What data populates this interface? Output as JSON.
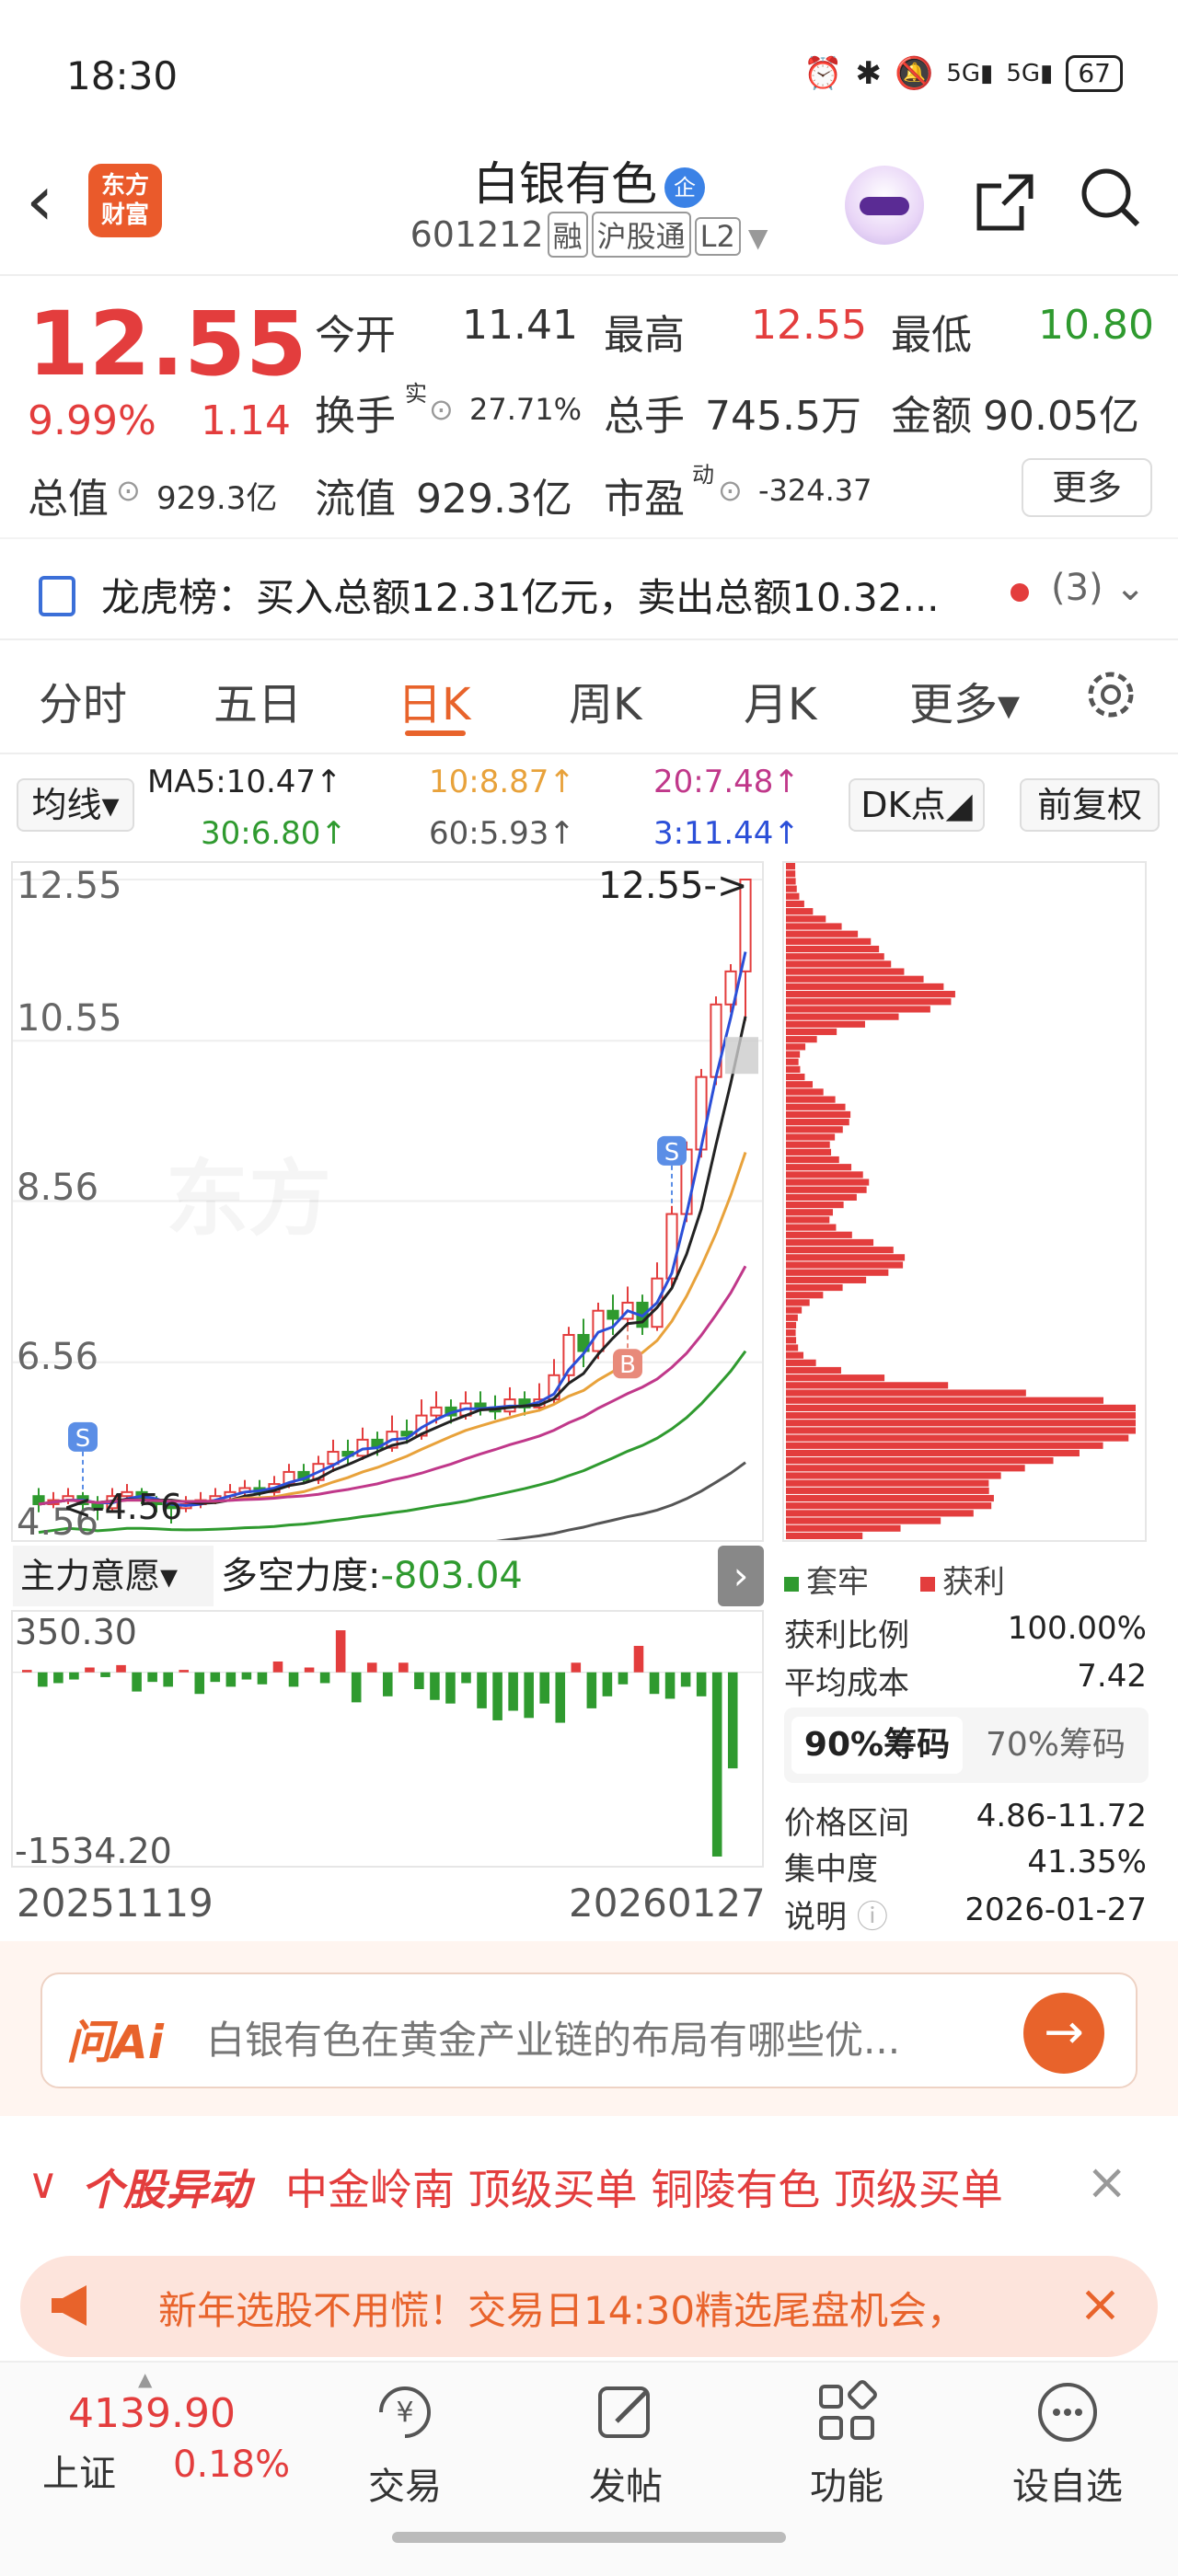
{
  "status": {
    "time": "18:30",
    "battery": "67",
    "signal1": "5G",
    "signal2": "5G"
  },
  "header": {
    "logo_line1": "东方",
    "logo_line2": "财富",
    "name": "白银有色",
    "badge": "企",
    "code": "601212",
    "tags": [
      "融",
      "沪股通",
      "L2"
    ]
  },
  "quote": {
    "price": "12.55",
    "pct": "9.99%",
    "change": "1.14",
    "open_label": "今开",
    "open": "11.41",
    "high_label": "最高",
    "high": "12.55",
    "low_label": "最低",
    "low": "10.80",
    "turnover_label": "换手",
    "turnover_sup": "实",
    "turnover": "27.71%",
    "volume_label": "总手",
    "volume": "745.5万",
    "amount_label": "金额",
    "amount": "90.05亿",
    "mktcap_label": "总值",
    "mktcap": "929.3亿",
    "float_label": "流值",
    "float": "929.3亿",
    "pe_label": "市盈",
    "pe_sup": "动",
    "pe": "-324.37",
    "more": "更多"
  },
  "lhb": {
    "text": "龙虎榜：买入总额12.31亿元，卖出总额10.32...",
    "count": "(3)"
  },
  "tabs": [
    "分时",
    "五日",
    "日K",
    "周K",
    "月K",
    "更多▾"
  ],
  "ma": {
    "toggle": "均线▾",
    "ma5": "MA5:10.47↑",
    "ma10": "10:8.87↑",
    "ma20": "20:7.48↑",
    "ma30": "30:6.80↑",
    "ma60": "60:5.93↑",
    "ma3": "3:11.44↑",
    "dk": "DK点◢",
    "fq": "前复权"
  },
  "colors": {
    "red": "#e33d3d",
    "green": "#2f9a2f",
    "orange": "#e8632b",
    "ma5": "#222222",
    "ma10": "#e8a23b",
    "ma20": "#c0388a",
    "ma30": "#2f9a2f",
    "ma60": "#555555",
    "ma3": "#2b4fd8"
  },
  "chart_data": [
    {
      "type": "candlestick",
      "price_ticks": [
        "12.55",
        "10.55",
        "8.56",
        "6.56",
        "4.56"
      ],
      "ylim": [
        4.56,
        12.55
      ],
      "last_price_label": "12.55->",
      "low_marker": "<-4.56",
      "candles": [
        [
          4.9,
          4.8,
          5.0,
          4.7
        ],
        [
          4.8,
          4.85,
          4.95,
          4.75
        ],
        [
          4.85,
          4.9,
          5.0,
          4.8
        ],
        [
          4.9,
          4.8,
          4.95,
          4.7
        ],
        [
          4.8,
          4.75,
          4.9,
          4.6
        ],
        [
          4.75,
          4.9,
          5.0,
          4.7
        ],
        [
          4.9,
          4.95,
          5.05,
          4.85
        ],
        [
          4.95,
          4.85,
          5.0,
          4.8
        ],
        [
          4.85,
          4.8,
          4.9,
          4.7
        ],
        [
          4.8,
          4.75,
          4.85,
          4.56
        ],
        [
          4.75,
          4.8,
          4.9,
          4.7
        ],
        [
          4.8,
          4.85,
          4.95,
          4.75
        ],
        [
          4.85,
          4.9,
          5.0,
          4.8
        ],
        [
          4.9,
          4.95,
          5.05,
          4.85
        ],
        [
          4.95,
          5.0,
          5.1,
          4.9
        ],
        [
          5.0,
          4.95,
          5.1,
          4.9
        ],
        [
          4.95,
          5.05,
          5.15,
          4.9
        ],
        [
          5.05,
          5.2,
          5.3,
          5.0
        ],
        [
          5.2,
          5.1,
          5.3,
          5.05
        ],
        [
          5.1,
          5.3,
          5.4,
          5.05
        ],
        [
          5.3,
          5.45,
          5.6,
          5.2
        ],
        [
          5.45,
          5.4,
          5.6,
          5.3
        ],
        [
          5.4,
          5.6,
          5.75,
          5.35
        ],
        [
          5.6,
          5.5,
          5.7,
          5.4
        ],
        [
          5.5,
          5.7,
          5.9,
          5.45
        ],
        [
          5.7,
          5.65,
          5.85,
          5.55
        ],
        [
          5.65,
          5.9,
          6.1,
          5.6
        ],
        [
          5.9,
          6.0,
          6.2,
          5.8
        ],
        [
          6.0,
          5.9,
          6.1,
          5.8
        ],
        [
          5.9,
          6.05,
          6.2,
          5.85
        ],
        [
          6.05,
          6.0,
          6.2,
          5.9
        ],
        [
          6.0,
          5.95,
          6.15,
          5.85
        ],
        [
          5.95,
          6.1,
          6.25,
          5.9
        ],
        [
          6.1,
          6.0,
          6.2,
          5.9
        ],
        [
          6.0,
          6.1,
          6.3,
          5.95
        ],
        [
          6.1,
          6.4,
          6.6,
          6.05
        ],
        [
          6.4,
          6.9,
          7.0,
          6.3
        ],
        [
          6.9,
          6.7,
          7.1,
          6.5
        ],
        [
          6.7,
          7.2,
          7.3,
          6.6
        ],
        [
          7.2,
          7.1,
          7.4,
          6.9
        ],
        [
          7.1,
          7.3,
          7.5,
          7.0
        ],
        [
          7.3,
          7.0,
          7.4,
          6.9
        ],
        [
          7.0,
          7.6,
          7.8,
          6.95
        ],
        [
          7.6,
          8.4,
          8.5,
          7.5
        ],
        [
          8.4,
          9.2,
          9.3,
          8.3
        ],
        [
          9.2,
          10.1,
          10.2,
          9.1
        ],
        [
          10.1,
          11.0,
          11.1,
          10.0
        ],
        [
          11.0,
          11.41,
          11.5,
          10.9
        ],
        [
          11.41,
          12.55,
          12.55,
          10.8
        ]
      ],
      "markers": [
        {
          "label": "S",
          "index": 3
        },
        {
          "label": "S",
          "index": 43
        },
        {
          "label": "B",
          "index": 40
        }
      ]
    },
    {
      "type": "bar",
      "name": "主力意愿",
      "ticks": [
        "350.30",
        "-1534.20"
      ],
      "ylim": [
        -1534.2,
        350.3
      ],
      "x_start": "20251119",
      "x_end": "20260127",
      "values": [
        20,
        -120,
        -90,
        -60,
        40,
        -40,
        60,
        -160,
        -80,
        -120,
        20,
        -180,
        -80,
        -120,
        -60,
        -100,
        90,
        -120,
        40,
        -90,
        350,
        -250,
        80,
        -200,
        80,
        -140,
        -230,
        -260,
        -90,
        -300,
        -400,
        -320,
        -380,
        -260,
        -420,
        80,
        -300,
        -200,
        -100,
        220,
        -180,
        -220,
        -120,
        -200,
        -1534,
        -800
      ]
    },
    {
      "type": "bar-horizontal",
      "name": "筹码分布",
      "price_range": [
        4.56,
        12.55
      ],
      "levels": 90
    }
  ],
  "indicator": {
    "label": "主力意愿▾",
    "name": "多空力度:",
    "value": "-803.04"
  },
  "dates": {
    "start": "20251119",
    "end": "20260127"
  },
  "chips": {
    "legend_loss": "套牢",
    "legend_profit": "获利",
    "profit_ratio_label": "获利比例",
    "profit_ratio": "100.00%",
    "avg_cost_label": "平均成本",
    "avg_cost": "7.42",
    "tab90": "90%筹码",
    "tab70": "70%筹码",
    "range_label": "价格区间",
    "range": "4.86-11.72",
    "concentration_label": "集中度",
    "concentration": "41.35%",
    "note_label": "说明",
    "note_date": "2026-01-27"
  },
  "ai": {
    "logo": "问Ai",
    "prompt": "白银有色在黄金产业链的布局有哪些优..."
  },
  "alerts": {
    "title": "个股异动",
    "items": "中金岭南  顶级买单  铜陵有色  顶级买单"
  },
  "banner": {
    "text": "新年选股不用慌！交易日14:30精选尾盘机会，"
  },
  "bottom": {
    "index_value": "4139.90",
    "index_name": "上证",
    "index_pct": "0.18%",
    "nav": [
      "交易",
      "发帖",
      "功能",
      "设自选"
    ]
  }
}
